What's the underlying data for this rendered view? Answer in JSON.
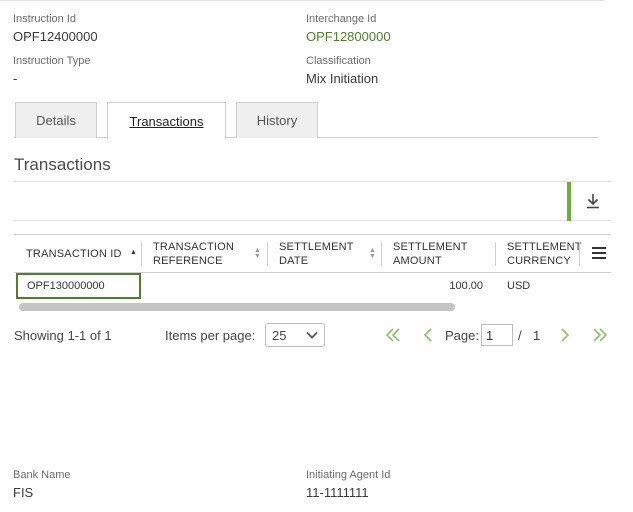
{
  "details": {
    "instruction_id_label": "Instruction Id",
    "instruction_id_value": "OPF12400000",
    "interchange_id_label": "Interchange Id",
    "interchange_id_value": "OPF12800000",
    "instruction_type_label": "Instruction Type",
    "instruction_type_value": "-",
    "classification_label": "Classification",
    "classification_value": "Mix Initiation"
  },
  "tabs": [
    {
      "label": "Details",
      "active": false
    },
    {
      "label": "Transactions",
      "active": true
    },
    {
      "label": "History",
      "active": false
    }
  ],
  "section_title": "Transactions",
  "icons": {
    "download": "download-icon",
    "column_menu": "menu-icon",
    "sort": "sort-icon",
    "first": "double-chevron-left-icon",
    "prev": "chevron-left-icon",
    "next": "chevron-right-icon",
    "last": "double-chevron-right-icon",
    "dropdown": "chevron-down-icon"
  },
  "table": {
    "columns": [
      {
        "label": "TRANSACTION ID"
      },
      {
        "label": "TRANSACTION REFERENCE"
      },
      {
        "label": "SETTLEMENT DATE"
      },
      {
        "label": "SETTLEMENT AMOUNT"
      },
      {
        "label": "SETTLEMENT CURRENCY"
      }
    ],
    "rows": [
      {
        "transaction_id": "OPF130000000",
        "transaction_reference": "",
        "settlement_date": "",
        "settlement_amount": "100.00",
        "settlement_currency": "USD"
      }
    ]
  },
  "pager": {
    "showing": "Showing 1-1 of 1",
    "items_per_page_label": "Items per page:",
    "items_per_page_value": "25",
    "page_label": "Page:",
    "page_value": "1",
    "separator": "/",
    "total_pages": "1"
  },
  "footer": {
    "bank_name_label": "Bank Name",
    "bank_name_value": "FIS",
    "initiating_agent_label": "Initiating Agent Id",
    "initiating_agent_value": "11-1111111"
  },
  "colors": {
    "accent": "#6cae3e",
    "link": "#4f7f2c",
    "nav": "#8fbf6a"
  }
}
